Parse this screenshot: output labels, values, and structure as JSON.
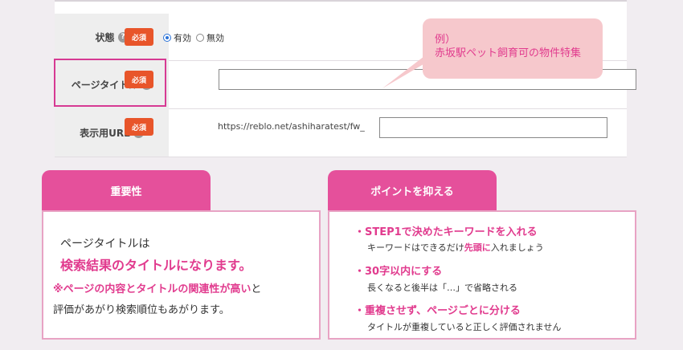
{
  "form": {
    "rows": [
      {
        "label": "状態",
        "required": "必須"
      },
      {
        "label": "ページタイトル",
        "required": "必須"
      },
      {
        "label": "表示用URL",
        "required": "必須"
      }
    ],
    "help_glyph": "?",
    "status_options": [
      "有効",
      "無効"
    ],
    "status_selected": "有効",
    "title_value": "",
    "url_prefix": "https://reblo.net/ashiharatest/fw_",
    "url_value": ""
  },
  "bubble": {
    "line1": "例）",
    "line2": "赤坂駅ペット飼育可の物件特集"
  },
  "importance": {
    "tab": "重要性",
    "text1": "ページタイトルは",
    "text2": "検索結果のタイトルになります。",
    "text3_highlight": "※ページの内容とタイトルの関連性が高い",
    "text3_rest": "と",
    "text4": "評価があがり検索順位もあがります。"
  },
  "points": {
    "tab": "ポイントを抑える",
    "items": [
      {
        "title": "・STEP1で決めたキーワードを入れる",
        "sub_a": "キーワードはできるだけ",
        "sub_highlight": "先頭に",
        "sub_b": "入れましょう"
      },
      {
        "title": "・30字以内にする",
        "sub_a": "長くなると後半は「…」で省略される",
        "sub_highlight": "",
        "sub_b": ""
      },
      {
        "title": "・重複させず、ページごとに分ける",
        "sub_a": "タイトルが重複していると正しく評価されません",
        "sub_highlight": "",
        "sub_b": ""
      }
    ]
  },
  "colors": {
    "accent": "#e5509b",
    "required_badge": "#e8552a",
    "highlight_text": "#e13b8e"
  }
}
